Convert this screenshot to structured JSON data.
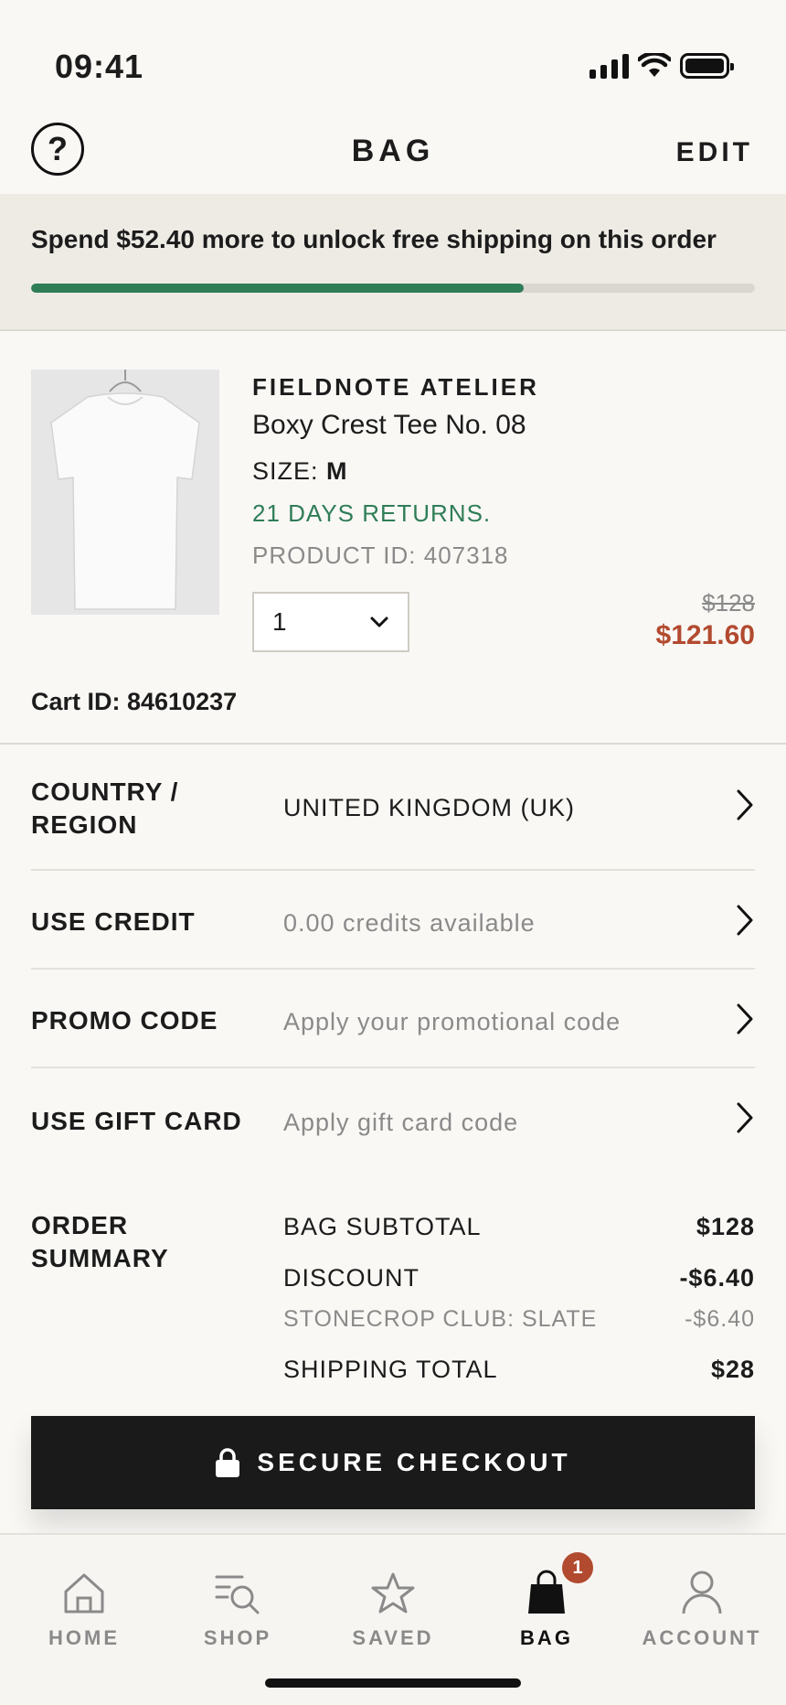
{
  "status_bar": {
    "time": "09:41"
  },
  "header": {
    "title": "BAG",
    "help_symbol": "?",
    "edit_label": "EDIT"
  },
  "shipping": {
    "message": "Spend $52.40 more to unlock free shipping on this order",
    "progress": 0.68,
    "fill_color": "#2f7d57"
  },
  "product": {
    "brand": "FIELDNOTE ATELIER",
    "name": "Boxy Crest Tee No. 08",
    "size_label": "SIZE:",
    "size_value": "M",
    "returns": "21 DAYS RETURNS.",
    "product_id": "PRODUCT ID: 407318",
    "quantity": "1",
    "price_original": "$128",
    "price_sale": "$121.60",
    "image_icon": "white-tshirt-image"
  },
  "cart": {
    "id_text": "Cart ID: 84610237"
  },
  "rows": {
    "country": {
      "label_line1": "COUNTRY /",
      "label_line2": "REGION",
      "value": "UNITED KINGDOM (UK)"
    },
    "credit": {
      "label": "USE CREDIT",
      "value": "0.00 credits available"
    },
    "promo": {
      "label": "PROMO CODE",
      "value": "Apply your promotional code"
    },
    "gift": {
      "label": "USE GIFT CARD",
      "value": "Apply gift card code"
    }
  },
  "summary": {
    "label_line1": "ORDER",
    "label_line2": "SUMMARY",
    "lines": [
      {
        "label": "BAG SUBTOTAL",
        "value": "$128"
      },
      {
        "label": "DISCOUNT",
        "value": "-$6.40"
      },
      {
        "label": "STONECROP CLUB: SLATE",
        "value": "-$6.40"
      },
      {
        "label": "SHIPPING TOTAL",
        "value": "$28"
      }
    ]
  },
  "checkout": {
    "label": "SECURE CHECKOUT",
    "icon": "lock-icon"
  },
  "tabbar": {
    "tabs": [
      {
        "label": "HOME",
        "icon": "home-icon"
      },
      {
        "label": "SHOP",
        "icon": "search-list-icon"
      },
      {
        "label": "SAVED",
        "icon": "star-icon"
      },
      {
        "label": "BAG",
        "icon": "bag-icon",
        "active": true,
        "badge": "1"
      },
      {
        "label": "ACCOUNT",
        "icon": "person-icon"
      }
    ]
  },
  "colors": {
    "accent_green": "#2f7d57",
    "sale_red": "#b24a2f",
    "dark": "#1a1a1a"
  }
}
